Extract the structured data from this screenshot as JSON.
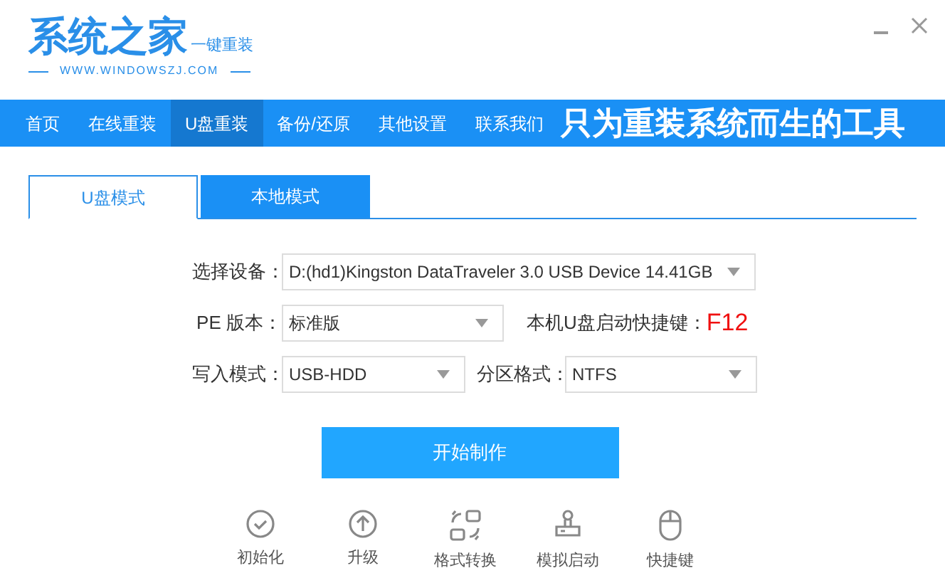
{
  "logo": {
    "title": "系统之家",
    "subtitle": "一键重装",
    "url": "WWW.WINDOWSZJ.COM"
  },
  "window_controls": [
    {
      "kind": "minimize"
    },
    {
      "kind": "close"
    }
  ],
  "nav": {
    "items": [
      {
        "label": "首页",
        "selected": false
      },
      {
        "label": "在线重装",
        "selected": false
      },
      {
        "label": "U盘重装",
        "selected": true
      },
      {
        "label": "备份/还原",
        "selected": false
      },
      {
        "label": "其他设置",
        "selected": false
      },
      {
        "label": "联系我们",
        "selected": false
      }
    ],
    "slogan": "只为重装系统而生的工具"
  },
  "tabs": [
    {
      "label": "U盘模式",
      "selected": true
    },
    {
      "label": "本地模式",
      "selected": false
    }
  ],
  "form": {
    "device": {
      "label": "选择设备：",
      "value": "D:(hd1)Kingston DataTraveler 3.0 USB Device 14.41GB"
    },
    "pe_version": {
      "label": "PE 版本：",
      "value": "标准版"
    },
    "hotkey": {
      "label": "本机U盘启动快捷键：",
      "value": "F12"
    },
    "write_mode": {
      "label": "写入模式：",
      "value": "USB-HDD"
    },
    "partition": {
      "label": "分区格式：",
      "value": "NTFS"
    }
  },
  "start_button": "开始制作",
  "tools": [
    {
      "kind": "init",
      "label": "初始化"
    },
    {
      "kind": "upgrade",
      "label": "升级"
    },
    {
      "kind": "convert",
      "label": "格式转换"
    },
    {
      "kind": "simulate",
      "label": "模拟启动"
    },
    {
      "kind": "hotkey",
      "label": "快捷键"
    }
  ]
}
